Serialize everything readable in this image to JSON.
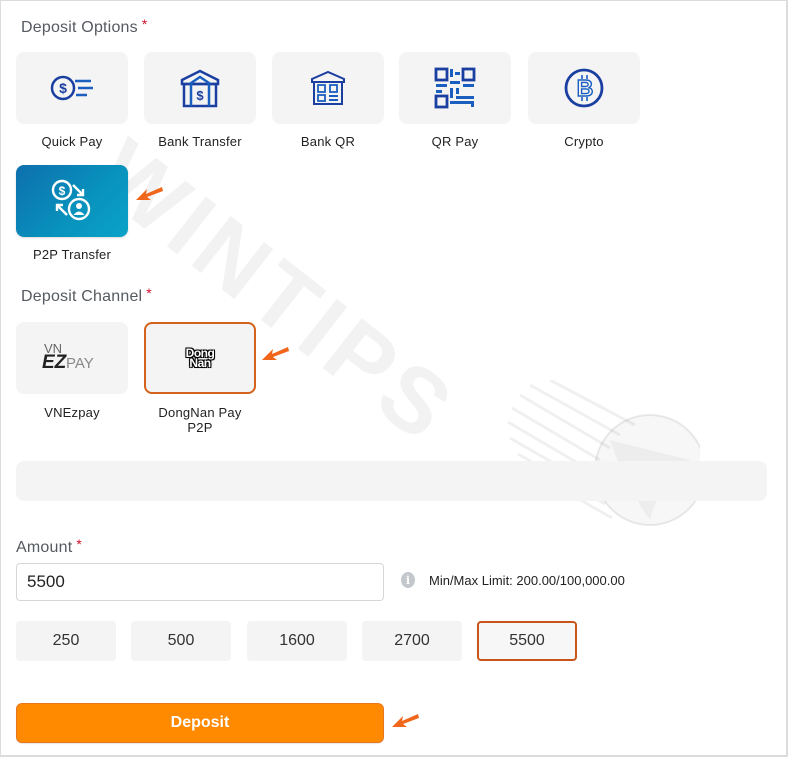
{
  "deposit_options": {
    "title": "Deposit Options",
    "required_mark": "*",
    "items": [
      {
        "label": "Quick Pay",
        "icon": "quick-pay-icon"
      },
      {
        "label": "Bank Transfer",
        "icon": "bank-transfer-icon"
      },
      {
        "label": "Bank QR",
        "icon": "bank-qr-icon"
      },
      {
        "label": "QR Pay",
        "icon": "qr-pay-icon"
      },
      {
        "label": "Crypto",
        "icon": "bitcoin-icon"
      },
      {
        "label": "P2P Transfer",
        "icon": "p2p-transfer-icon",
        "active": true
      }
    ]
  },
  "deposit_channel": {
    "title": "Deposit Channel",
    "required_mark": "*",
    "items": [
      {
        "label": "VNEzpay",
        "logo_top": "VN",
        "logo_bold": "EZ",
        "logo_light": "PAY"
      },
      {
        "label": "DongNan Pay P2P",
        "label_line1": "DongNan Pay",
        "label_line2": "P2P",
        "logo_line1": "Dong",
        "logo_line2": "Nan",
        "selected": true
      }
    ]
  },
  "amount": {
    "label": "Amount",
    "required_mark": "*",
    "value": "5500",
    "limit_text": "Min/Max Limit: 200.00/100,000.00",
    "info_glyph": "i",
    "presets": [
      "250",
      "500",
      "1600",
      "2700",
      "5500"
    ],
    "selected_preset": "5500"
  },
  "submit": {
    "label": "Deposit"
  },
  "watermark": {
    "text": "WINTIPS"
  },
  "colors": {
    "accent_orange": "#ff8a00",
    "selected_border": "#d2621c",
    "active_tile": "#0a86b8",
    "required": "#d0102b",
    "icon_blue": "#1a3fa0"
  }
}
